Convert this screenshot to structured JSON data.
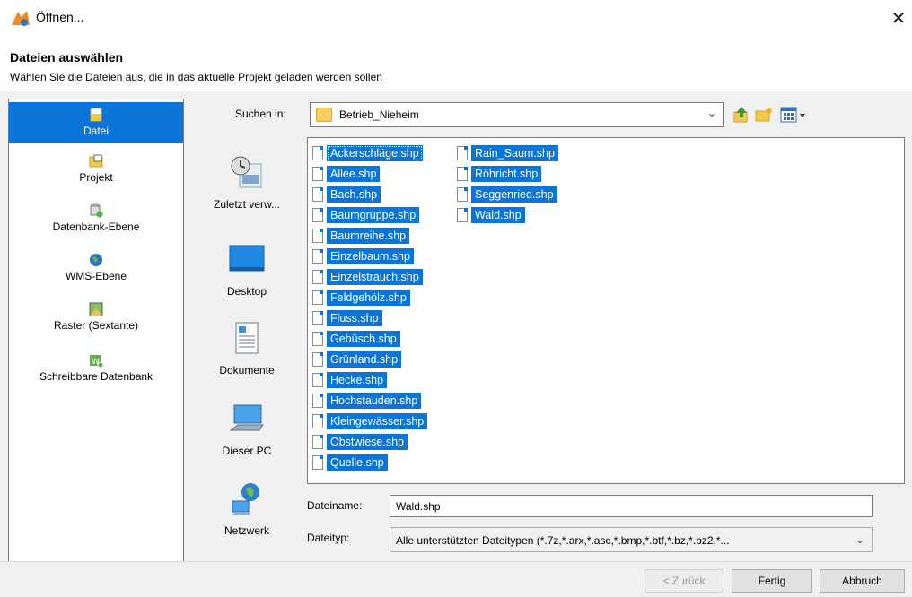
{
  "window": {
    "title": "Öffnen..."
  },
  "header": {
    "title": "Dateien auswählen",
    "subtitle": "Wählen Sie die Dateien aus, die in das aktuelle Projekt geladen werden sollen"
  },
  "sidebar": {
    "items": [
      {
        "label": "Datei",
        "icon": "file-icon",
        "active": true
      },
      {
        "label": "Projekt",
        "icon": "project-icon"
      },
      {
        "label": "Datenbank-Ebene",
        "icon": "database-icon"
      },
      {
        "label": "WMS-Ebene",
        "icon": "globe-icon"
      },
      {
        "label": "Raster (Sextante)",
        "icon": "raster-icon"
      },
      {
        "label": "Schreibbare Datenbank",
        "icon": "writable-db-icon"
      }
    ]
  },
  "chooser": {
    "look_in_label": "Suchen in:",
    "look_in_value": "Betrieb_Nieheim",
    "places": [
      {
        "label": "Zuletzt verw...",
        "icon": "recent-icon"
      },
      {
        "label": "Desktop",
        "icon": "desktop-icon"
      },
      {
        "label": "Dokumente",
        "icon": "documents-icon"
      },
      {
        "label": "Dieser PC",
        "icon": "computer-icon"
      },
      {
        "label": "Netzwerk",
        "icon": "network-icon"
      }
    ],
    "files_col1": [
      "Ackerschläge.shp",
      "Allee.shp",
      "Bach.shp",
      "Baumgruppe.shp",
      "Baumreihe.shp",
      "Einzelbaum.shp",
      "Einzelstrauch.shp",
      "Feldgehölz.shp",
      "Fluss.shp",
      "Gebüsch.shp",
      "Grünland.shp",
      "Hecke.shp",
      "Hochstauden.shp",
      "Kleingewässer.shp",
      "Obstwiese.shp",
      "Quelle.shp"
    ],
    "files_col2": [
      "Rain_Saum.shp",
      "Röhricht.shp",
      "Seggenried.shp",
      "Wald.shp"
    ],
    "filename_label": "Dateiname:",
    "filename_value": "Wald.shp",
    "filetype_label": "Dateityp:",
    "filetype_value": "Alle unterstützten Dateitypen (*.7z,*.arx,*.asc,*.bmp,*.btf,*.bz,*.bz2,*..."
  },
  "footer": {
    "back_label": "< Zurück",
    "finish_label": "Fertig",
    "cancel_label": "Abbruch"
  },
  "colors": {
    "selection": "#0a74d9",
    "panel": "#f0f0f0"
  }
}
